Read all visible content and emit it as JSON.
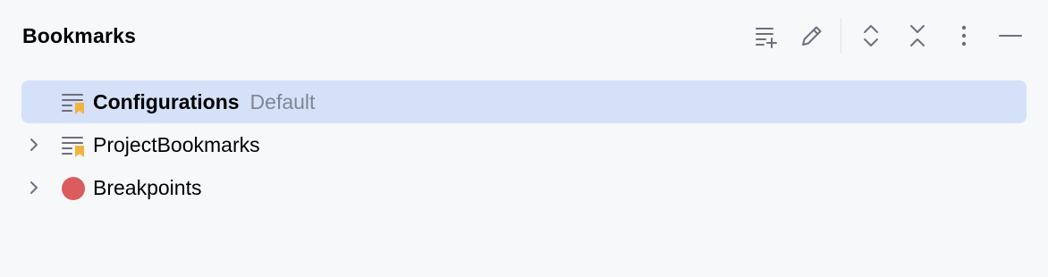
{
  "header": {
    "title": "Bookmarks"
  },
  "toolbar": {
    "icons": [
      "add-list-icon",
      "edit-pencil-icon",
      "expand-all-icon",
      "collapse-all-icon",
      "more-vertical-icon",
      "minimize-icon"
    ]
  },
  "tree": {
    "items": [
      {
        "label": "Configurations",
        "hint": "Default",
        "icon": "bookmark-list-icon",
        "selected": true,
        "expandable": false
      },
      {
        "label": "ProjectBookmarks",
        "hint": "",
        "icon": "bookmark-list-icon",
        "selected": false,
        "expandable": true
      },
      {
        "label": "Breakpoints",
        "hint": "",
        "icon": "breakpoint-icon",
        "selected": false,
        "expandable": true
      }
    ]
  },
  "colors": {
    "background": "#f7f8fa",
    "selection": "#d5e1f9",
    "bookmark_accent": "#f2b33d",
    "breakpoint": "#db5c5c",
    "hint_text": "#818594",
    "icon_stroke": "#6c707e"
  }
}
